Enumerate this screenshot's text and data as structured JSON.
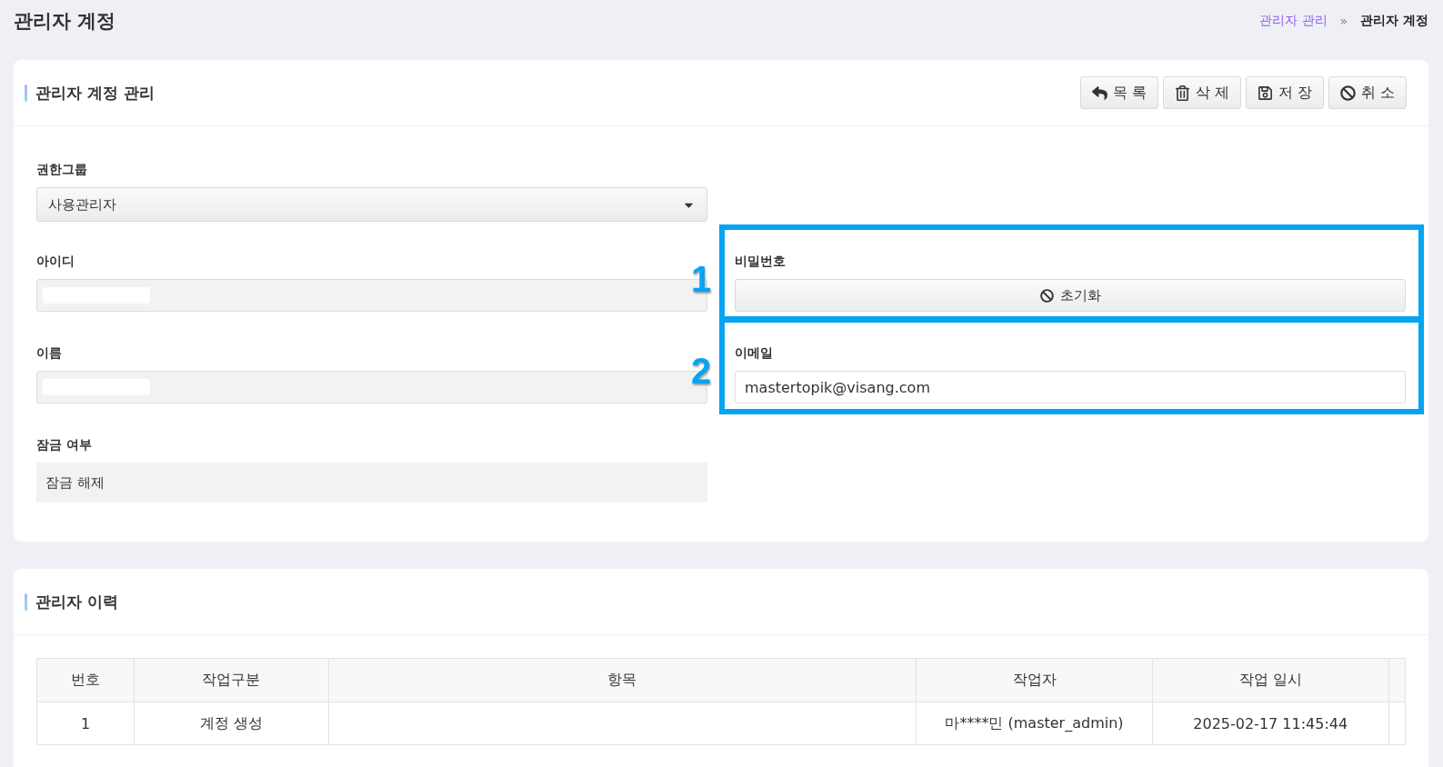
{
  "page": {
    "title": "관리자 계정",
    "breadcrumb": [
      {
        "label": "관리자 관리",
        "current": false
      },
      {
        "label": "관리자 계정",
        "current": true
      }
    ],
    "separator": "»"
  },
  "account_card": {
    "title": "관리자 계정 관리",
    "buttons": [
      {
        "label": "목 록",
        "kind": "list"
      },
      {
        "label": "삭 제",
        "kind": "delete"
      },
      {
        "label": "저 장",
        "kind": "save"
      },
      {
        "label": "취 소",
        "kind": "cancel"
      }
    ],
    "rows": [
      {
        "left": {
          "kind": "select",
          "label": "권한그룹",
          "value": "사용관리자"
        }
      },
      {
        "left": {
          "kind": "input",
          "label": "아이디",
          "redacted": true,
          "disabled": true
        },
        "right": {
          "kind": "button",
          "label": "비밀번호",
          "button": "초기화",
          "annotation": "1"
        }
      },
      {
        "left": {
          "kind": "input",
          "label": "이름",
          "redacted": true,
          "disabled": true
        },
        "right": {
          "kind": "input",
          "label": "이메일",
          "value": "mastertopik@visang.com",
          "disabled": false,
          "annotation": "2"
        }
      },
      {
        "left": {
          "kind": "static",
          "label": "잠금 여부",
          "value": "잠금 해제"
        }
      }
    ]
  },
  "history_card": {
    "title": "관리자 이력",
    "table": {
      "columns": [
        "번호",
        "작업구분",
        "항목",
        "작업자",
        "작업 일시"
      ],
      "rows": [
        {
          "number": "1",
          "action": "계정 생성",
          "worker": "마****민 (master_admin)",
          "time": "2025-02-17 11:45:44"
        }
      ]
    }
  }
}
